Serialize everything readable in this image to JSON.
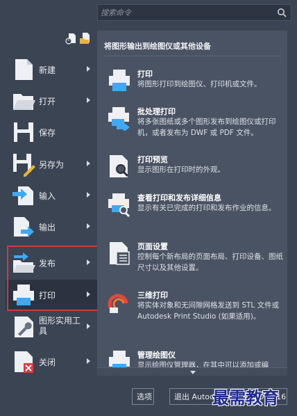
{
  "search": {
    "placeholder": "搜索命令"
  },
  "menu": {
    "items": [
      {
        "key": "new",
        "label": "新建",
        "has_arrow": true
      },
      {
        "key": "open",
        "label": "打开",
        "has_arrow": true
      },
      {
        "key": "save",
        "label": "保存",
        "has_arrow": false
      },
      {
        "key": "saveas",
        "label": "另存为",
        "has_arrow": true
      },
      {
        "key": "import",
        "label": "输入",
        "has_arrow": true
      },
      {
        "key": "export",
        "label": "输出",
        "has_arrow": true
      },
      {
        "key": "publish",
        "label": "发布",
        "has_arrow": true
      },
      {
        "key": "print",
        "label": "打印",
        "has_arrow": true,
        "active": true
      },
      {
        "key": "utilities",
        "label": "图形实用工具",
        "has_arrow": true
      },
      {
        "key": "close",
        "label": "关闭",
        "has_arrow": true
      }
    ]
  },
  "panel": {
    "title": "将图形输出到绘图仪或其他设备",
    "items": [
      {
        "title": "打印",
        "desc": "将图形打印到绘图仪、打印机或文件。"
      },
      {
        "title": "批处理打印",
        "desc": "将多张图纸或多个图形发布到绘图仪或打印机，或者发布为 DWF 或 PDF 文件。"
      },
      {
        "title": "打印预览",
        "desc": "显示图形在打印时的外观。"
      },
      {
        "title": "查看打印和发布详细信息",
        "desc": "显示有关已完成的打印和发布作业的信息。"
      },
      {
        "title": "页面设置",
        "desc": "控制每个新布局的页面布局、打印设备、图纸尺寸以及其他设置。"
      },
      {
        "title": "三维打印",
        "desc": "将实体对象和无间隙网格发送到 STL 文件或 Autodesk Print Studio (如果适用)。"
      },
      {
        "title": "管理绘图仪",
        "desc": "显示绘图仪管理器，在其中可以添加或编"
      }
    ]
  },
  "footer": {
    "options_label": "选项",
    "exit_label": "退出 Autodesk AutoCAD 2016"
  },
  "watermark": "最需教育",
  "colors": {
    "highlight_border": "#d9363e",
    "panel_bg": "#4a5363",
    "app_bg": "#3b4453"
  }
}
